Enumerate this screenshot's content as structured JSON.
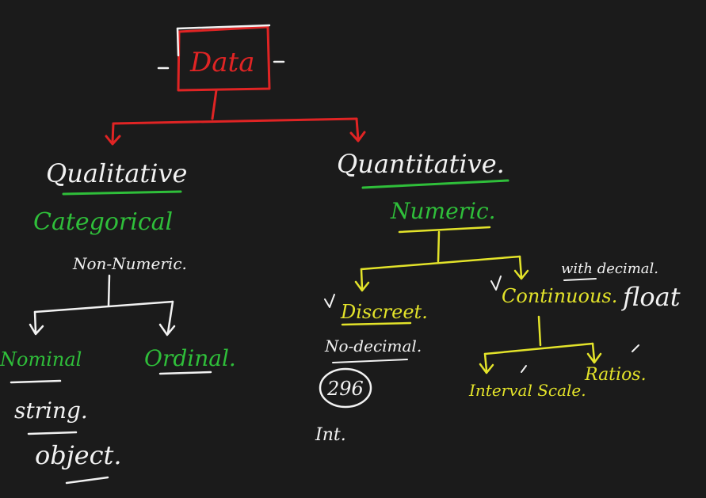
{
  "diagram": {
    "root": {
      "label": "Data",
      "color": "#e02424"
    },
    "qualitative": {
      "label": "Qualitative",
      "synonym": "Categorical",
      "note": "Non-Numeric.",
      "children": [
        "Nominal",
        "Ordinal."
      ],
      "nominal_examples": [
        "string.",
        "object."
      ]
    },
    "quantitative": {
      "label": "Quantitative.",
      "synonym": "Numeric.",
      "discrete": {
        "label": "Discreet.",
        "note": "No-decimal.",
        "example_number": "296",
        "example_type": "Int."
      },
      "continuous": {
        "label": "Continuous.",
        "note": "with decimal.",
        "type": "float",
        "children": [
          "Interval Scale.",
          "Ratios."
        ]
      }
    },
    "colors": {
      "background": "#1b1b1b",
      "white": "#f2f2f2",
      "red": "#e02424",
      "green": "#2fbf3a",
      "yellow": "#e3e32a"
    }
  }
}
